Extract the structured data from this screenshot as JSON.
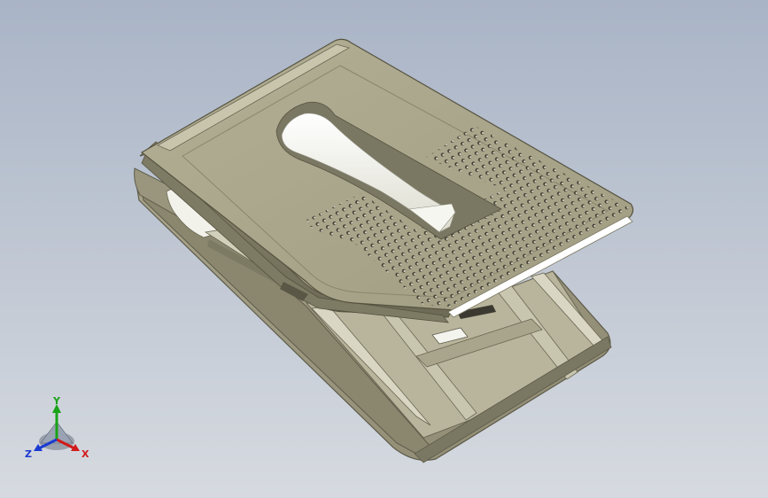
{
  "scene": {
    "background_top": "#a9b4c6",
    "background_bottom": "#d6dae0",
    "body_color": "#a09c82",
    "body_light": "#c8c5ae",
    "body_dark": "#6f6c58",
    "highlight": "#ffffff",
    "perforation_color": "#3a382c"
  },
  "triad": {
    "x_label": "X",
    "y_label": "Y",
    "z_label": "Z",
    "x_color": "#d11a1a",
    "y_color": "#19a319",
    "z_color": "#1a3ad1"
  }
}
